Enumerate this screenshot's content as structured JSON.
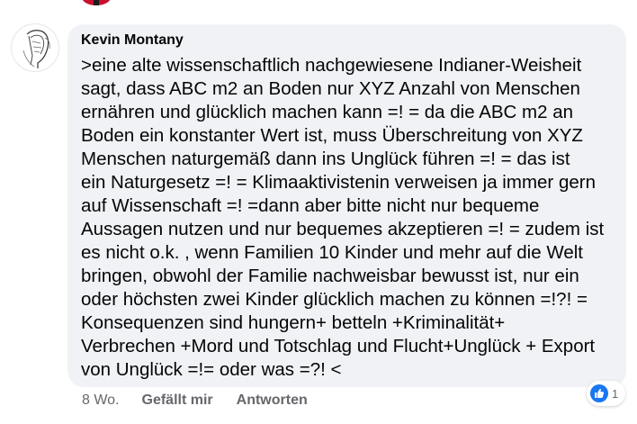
{
  "comment": {
    "author": "Kevin Montany",
    "text": ">eine alte wissenschaftlich nachgewiesene Indianer-Weisheit\nsagt, dass ABC  m2 an Boden nur XYZ Anzahl von Menschen\nernähren und glücklich machen kann =! = da die ABC m2 an\nBoden ein konstanter Wert   ist, muss Überschreitung von XYZ\nMenschen naturgemäß dann ins Unglück führen   =! = das ist\nein Naturgesetz =! = Klimaaktivistenin verweisen ja immer gern\nauf Wissenschaft =! =dann aber bitte nicht nur bequeme\nAussagen nutzen und nur bequemes akzeptieren =! = zudem ist\nes nicht o.k. , wenn Familien 10 Kinder und mehr auf die Welt\nbringen, obwohl der Familie nachweisbar bewusst ist, nur ein\noder höchsten zwei Kinder glücklich machen zu können =!?! =\nKonsequenzen sind hungern+ betteln +Kriminalität+\nVerbrechen +Mord und Totschlag und Flucht+Unglück + Export\nvon Unglück  =!= oder was =?! <"
  },
  "actions": {
    "time": "8 Wo.",
    "like_label": "Gefällt mir",
    "reply_label": "Antworten"
  },
  "reactions": {
    "icon": "like-thumbs-up-icon",
    "count": "1",
    "color": "#1877f2"
  },
  "colors": {
    "bubble": "#f0f2f5",
    "meta_text": "#65676b",
    "text": "#050505"
  }
}
